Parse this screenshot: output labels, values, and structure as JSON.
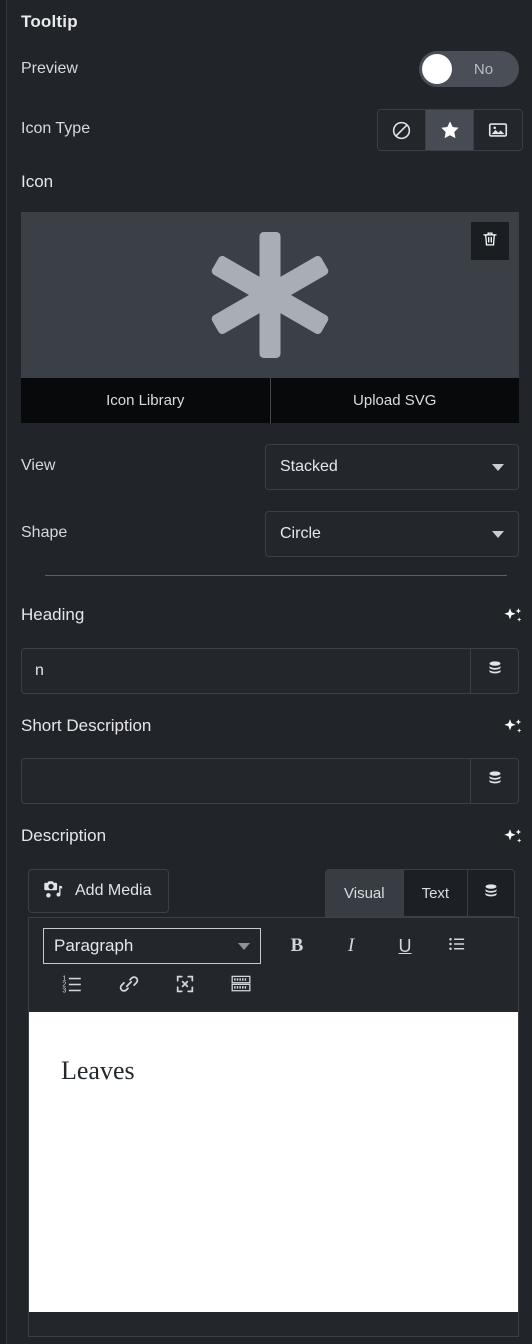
{
  "panel": {
    "title": "Tooltip"
  },
  "preview": {
    "label": "Preview",
    "toggle_state": "No",
    "enabled": false
  },
  "icon_type": {
    "label": "Icon Type",
    "options": [
      {
        "name": "none-icon",
        "label": "None",
        "selected": false
      },
      {
        "name": "star-icon",
        "label": "Icon",
        "selected": true
      },
      {
        "name": "image-icon",
        "label": "Image",
        "selected": false
      }
    ]
  },
  "icon": {
    "label": "Icon",
    "glyph_name": "asterisk-icon",
    "glyph_color": "#a9aeb4",
    "delete_button": "delete-icon",
    "actions": [
      {
        "label": "Icon Library",
        "name": "icon-library-button"
      },
      {
        "label": "Upload SVG",
        "name": "upload-svg-button"
      }
    ]
  },
  "view": {
    "label": "View",
    "value": "Stacked"
  },
  "shape": {
    "label": "Shape",
    "value": "Circle"
  },
  "heading": {
    "label": "Heading",
    "value": "n",
    "placeholder": "",
    "ai_icon": "sparkles-icon",
    "db_icon": "database-icon"
  },
  "short_description": {
    "label": "Short Description",
    "value": "",
    "placeholder": "",
    "ai_icon": "sparkles-icon",
    "db_icon": "database-icon"
  },
  "description": {
    "label": "Description",
    "ai_icon": "sparkles-icon",
    "add_media_label": "Add Media",
    "tabs": [
      {
        "label": "Visual",
        "active": true
      },
      {
        "label": "Text",
        "active": false
      }
    ],
    "db_icon": "database-icon",
    "toolbar": {
      "format_value": "Paragraph",
      "row1": [
        {
          "name": "bold-button",
          "glyph": "B"
        },
        {
          "name": "italic-button",
          "glyph": "I"
        },
        {
          "name": "underline-button",
          "glyph": "U"
        },
        {
          "name": "bulleted-list-button",
          "glyph": "list"
        }
      ],
      "row2": [
        {
          "name": "numbered-list-button",
          "glyph": "ordered-list"
        },
        {
          "name": "insert-link-button",
          "glyph": "link"
        },
        {
          "name": "fullscreen-button",
          "glyph": "expand"
        },
        {
          "name": "toolbar-toggle-button",
          "glyph": "keyboard"
        }
      ]
    },
    "content": "Leaves"
  },
  "colors": {
    "panel_bg": "#21252a",
    "preview_bg": "#3b4047",
    "action_bar_bg": "#07090a",
    "accent_active": "#474c54",
    "text_primary": "#e4e6ea",
    "editor_bg": "#ffffff"
  }
}
